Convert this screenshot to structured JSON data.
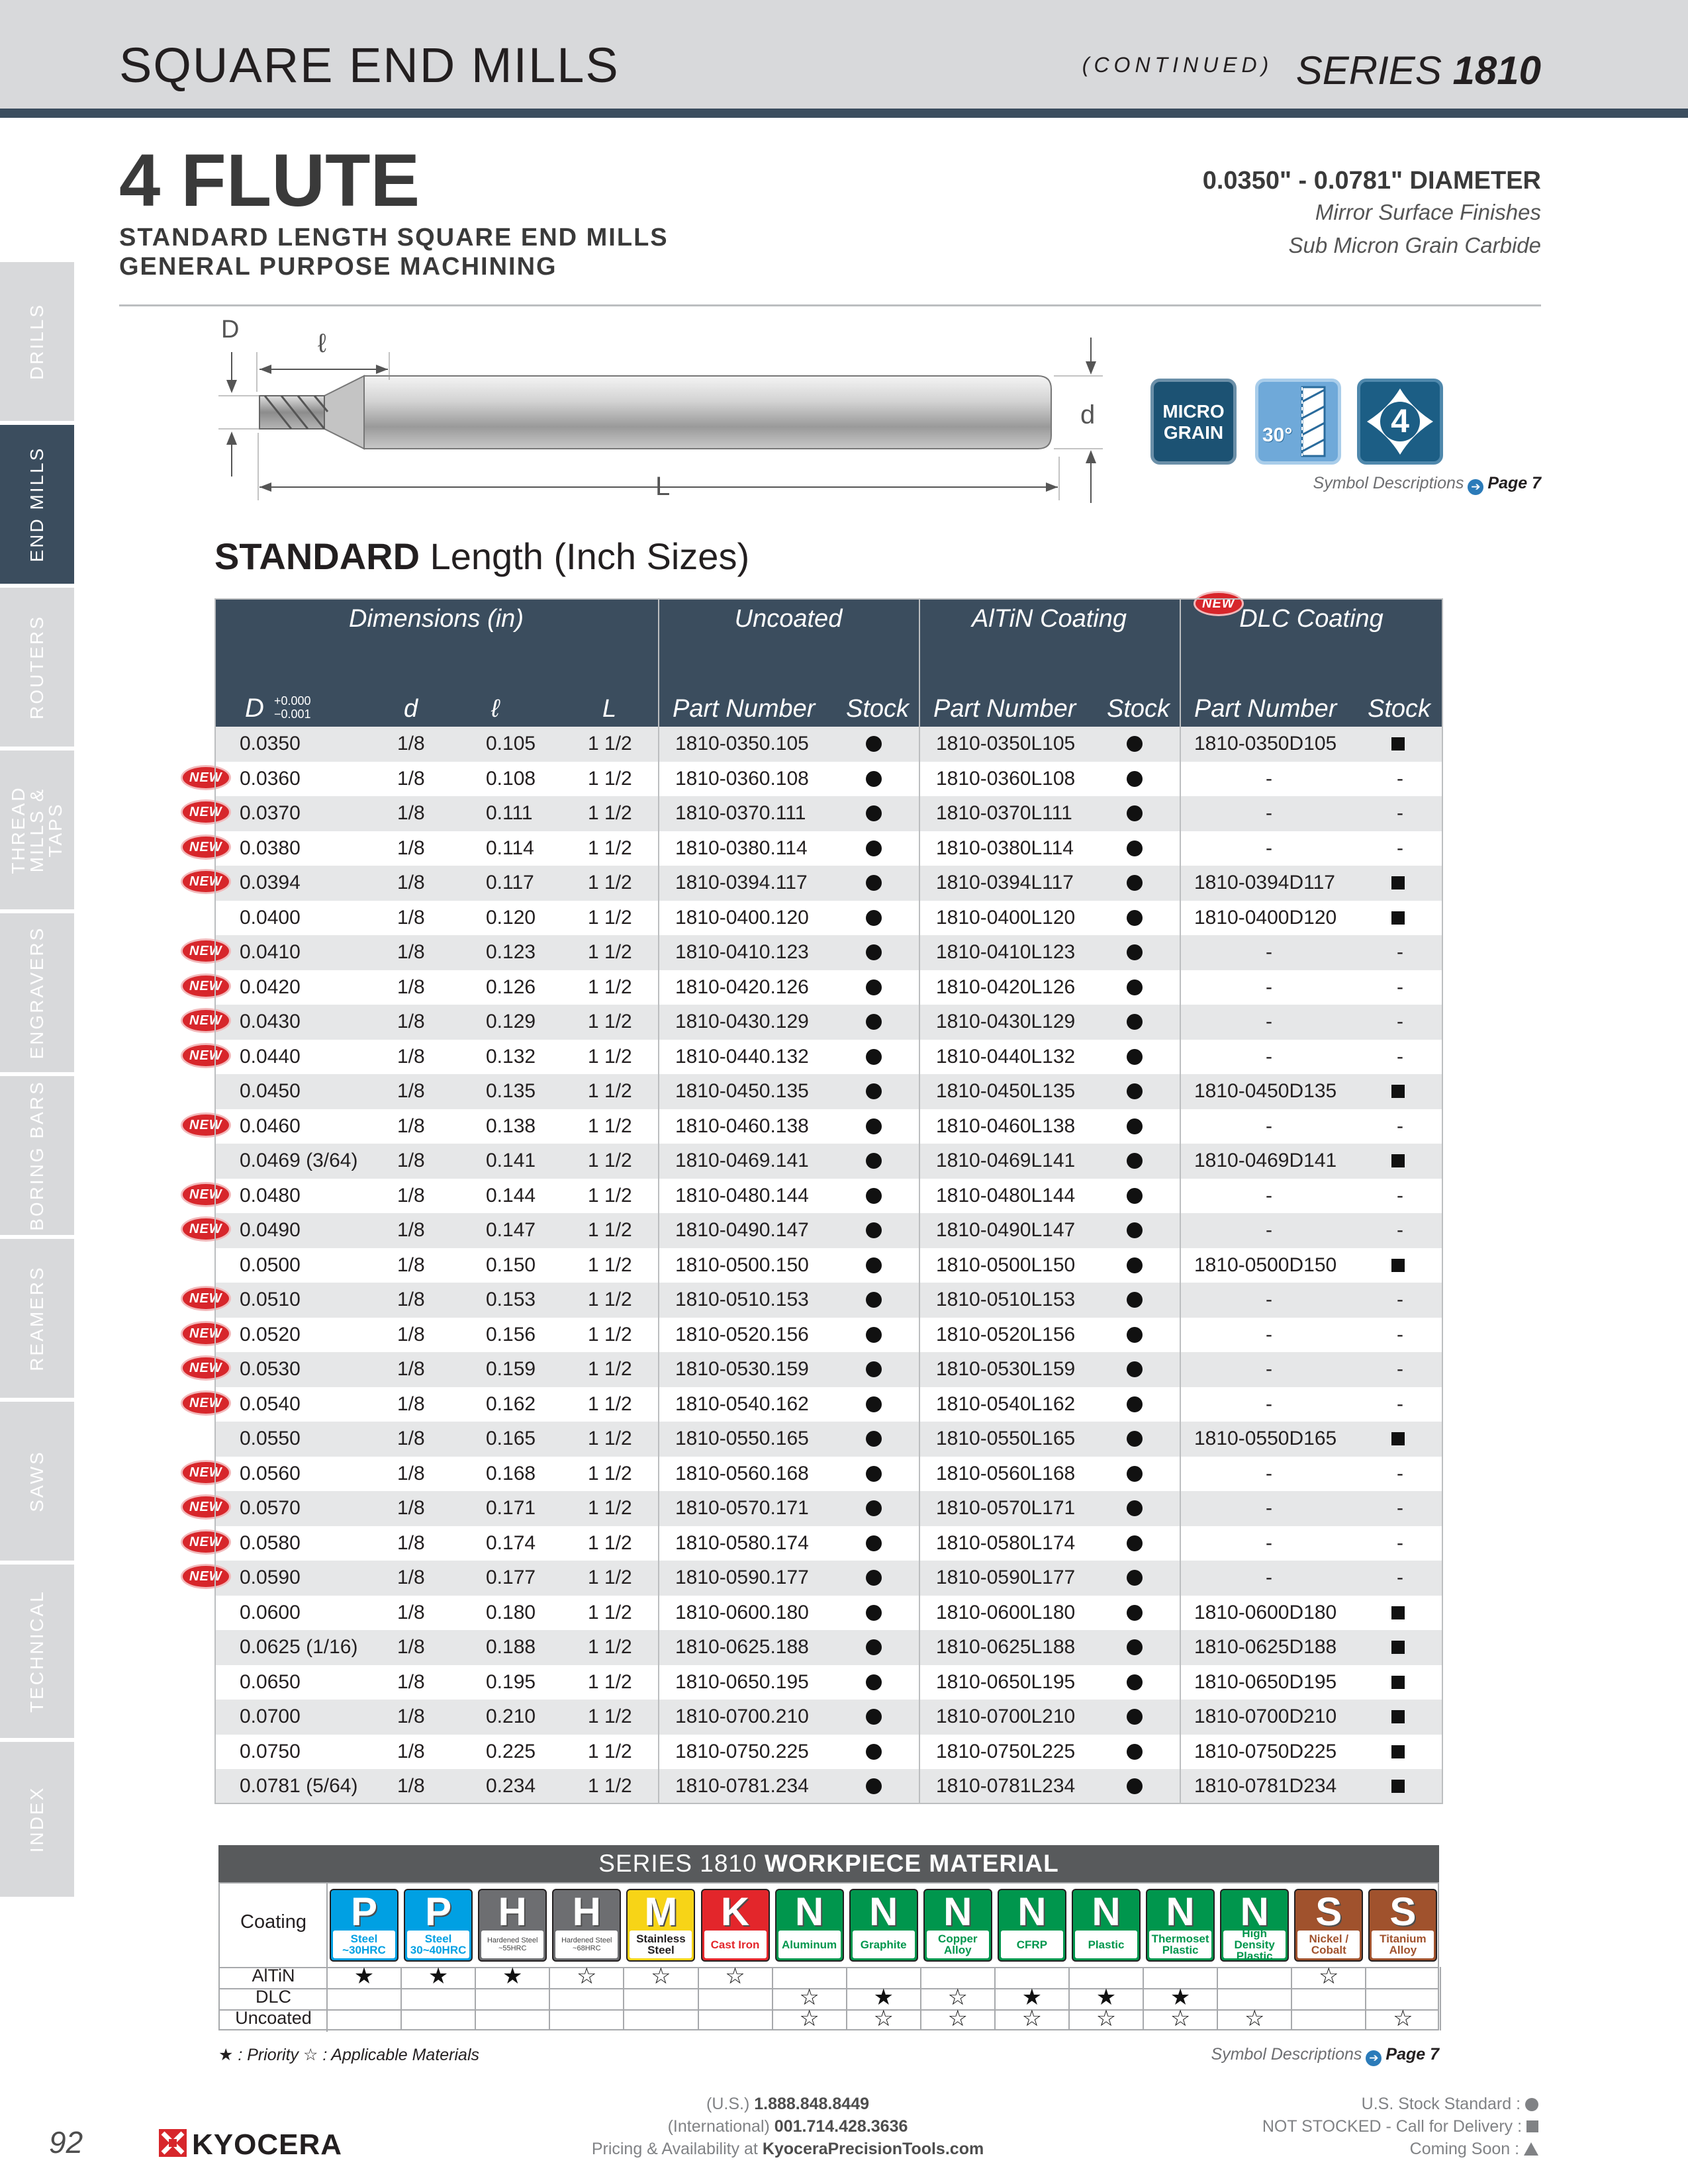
{
  "header": {
    "title": "SQUARE END MILLS",
    "continued": "(CONTINUED)",
    "series_prefix": "SERIES ",
    "series_number": "1810"
  },
  "side_tabs": [
    "DRILLS",
    "END MILLS",
    "ROUTERS",
    "THREAD MILLS & TAPS",
    "ENGRAVERS",
    "BORING BARS",
    "REAMERS",
    "SAWS",
    "TECHNICAL",
    "INDEX"
  ],
  "product": {
    "title": "4 FLUTE",
    "subtitle_line1": "STANDARD LENGTH SQUARE END MILLS",
    "subtitle_line2": "GENERAL PURPOSE MACHINING",
    "diameter_range": "0.0350\" - 0.0781\" DIAMETER",
    "finish_line1": "Mirror Surface Finishes",
    "finish_line2": "Sub Micron Grain Carbide"
  },
  "drawing": {
    "D": "D",
    "l": "ℓ",
    "L": "L",
    "d": "d"
  },
  "symbols": {
    "micro_grain_line1": "MICRO",
    "micro_grain_line2": "GRAIN",
    "helix": "30°",
    "flutes": "4",
    "ref_text": "Symbol Descriptions",
    "ref_page": "Page 7"
  },
  "table": {
    "heading_bold": "STANDARD",
    "heading_rest": " Length (Inch Sizes)",
    "groups": {
      "dimensions": "Dimensions (in)",
      "uncoated": "Uncoated",
      "altin": "AlTiN Coating",
      "dlc": "DLC Coating",
      "new_label": "NEW"
    },
    "columns": {
      "D": "D",
      "tol_plus": "+0.000",
      "tol_minus": "−0.001",
      "d": "d",
      "l": "ℓ",
      "L": "L",
      "part_number": "Part Number",
      "stock": "Stock"
    },
    "rows": [
      {
        "D": "0.0350",
        "new": false,
        "d": "1/8",
        "l": "0.105",
        "L": "1 1/2",
        "unc": "1810-0350.105",
        "alt": "1810-0350L105",
        "dlc": "1810-0350D105"
      },
      {
        "D": "0.0360",
        "new": true,
        "d": "1/8",
        "l": "0.108",
        "L": "1 1/2",
        "unc": "1810-0360.108",
        "alt": "1810-0360L108",
        "dlc": "-"
      },
      {
        "D": "0.0370",
        "new": true,
        "d": "1/8",
        "l": "0.111",
        "L": "1 1/2",
        "unc": "1810-0370.111",
        "alt": "1810-0370L111",
        "dlc": "-"
      },
      {
        "D": "0.0380",
        "new": true,
        "d": "1/8",
        "l": "0.114",
        "L": "1 1/2",
        "unc": "1810-0380.114",
        "alt": "1810-0380L114",
        "dlc": "-"
      },
      {
        "D": "0.0394",
        "new": true,
        "d": "1/8",
        "l": "0.117",
        "L": "1 1/2",
        "unc": "1810-0394.117",
        "alt": "1810-0394L117",
        "dlc": "1810-0394D117"
      },
      {
        "D": "0.0400",
        "new": false,
        "d": "1/8",
        "l": "0.120",
        "L": "1 1/2",
        "unc": "1810-0400.120",
        "alt": "1810-0400L120",
        "dlc": "1810-0400D120"
      },
      {
        "D": "0.0410",
        "new": true,
        "d": "1/8",
        "l": "0.123",
        "L": "1 1/2",
        "unc": "1810-0410.123",
        "alt": "1810-0410L123",
        "dlc": "-"
      },
      {
        "D": "0.0420",
        "new": true,
        "d": "1/8",
        "l": "0.126",
        "L": "1 1/2",
        "unc": "1810-0420.126",
        "alt": "1810-0420L126",
        "dlc": "-"
      },
      {
        "D": "0.0430",
        "new": true,
        "d": "1/8",
        "l": "0.129",
        "L": "1 1/2",
        "unc": "1810-0430.129",
        "alt": "1810-0430L129",
        "dlc": "-"
      },
      {
        "D": "0.0440",
        "new": true,
        "d": "1/8",
        "l": "0.132",
        "L": "1 1/2",
        "unc": "1810-0440.132",
        "alt": "1810-0440L132",
        "dlc": "-"
      },
      {
        "D": "0.0450",
        "new": false,
        "d": "1/8",
        "l": "0.135",
        "L": "1 1/2",
        "unc": "1810-0450.135",
        "alt": "1810-0450L135",
        "dlc": "1810-0450D135"
      },
      {
        "D": "0.0460",
        "new": true,
        "d": "1/8",
        "l": "0.138",
        "L": "1 1/2",
        "unc": "1810-0460.138",
        "alt": "1810-0460L138",
        "dlc": "-"
      },
      {
        "D": "0.0469 (3/64)",
        "new": false,
        "d": "1/8",
        "l": "0.141",
        "L": "1 1/2",
        "unc": "1810-0469.141",
        "alt": "1810-0469L141",
        "dlc": "1810-0469D141"
      },
      {
        "D": "0.0480",
        "new": true,
        "d": "1/8",
        "l": "0.144",
        "L": "1 1/2",
        "unc": "1810-0480.144",
        "alt": "1810-0480L144",
        "dlc": "-"
      },
      {
        "D": "0.0490",
        "new": true,
        "d": "1/8",
        "l": "0.147",
        "L": "1 1/2",
        "unc": "1810-0490.147",
        "alt": "1810-0490L147",
        "dlc": "-"
      },
      {
        "D": "0.0500",
        "new": false,
        "d": "1/8",
        "l": "0.150",
        "L": "1 1/2",
        "unc": "1810-0500.150",
        "alt": "1810-0500L150",
        "dlc": "1810-0500D150"
      },
      {
        "D": "0.0510",
        "new": true,
        "d": "1/8",
        "l": "0.153",
        "L": "1 1/2",
        "unc": "1810-0510.153",
        "alt": "1810-0510L153",
        "dlc": "-"
      },
      {
        "D": "0.0520",
        "new": true,
        "d": "1/8",
        "l": "0.156",
        "L": "1 1/2",
        "unc": "1810-0520.156",
        "alt": "1810-0520L156",
        "dlc": "-"
      },
      {
        "D": "0.0530",
        "new": true,
        "d": "1/8",
        "l": "0.159",
        "L": "1 1/2",
        "unc": "1810-0530.159",
        "alt": "1810-0530L159",
        "dlc": "-"
      },
      {
        "D": "0.0540",
        "new": true,
        "d": "1/8",
        "l": "0.162",
        "L": "1 1/2",
        "unc": "1810-0540.162",
        "alt": "1810-0540L162",
        "dlc": "-"
      },
      {
        "D": "0.0550",
        "new": false,
        "d": "1/8",
        "l": "0.165",
        "L": "1 1/2",
        "unc": "1810-0550.165",
        "alt": "1810-0550L165",
        "dlc": "1810-0550D165"
      },
      {
        "D": "0.0560",
        "new": true,
        "d": "1/8",
        "l": "0.168",
        "L": "1 1/2",
        "unc": "1810-0560.168",
        "alt": "1810-0560L168",
        "dlc": "-"
      },
      {
        "D": "0.0570",
        "new": true,
        "d": "1/8",
        "l": "0.171",
        "L": "1 1/2",
        "unc": "1810-0570.171",
        "alt": "1810-0570L171",
        "dlc": "-"
      },
      {
        "D": "0.0580",
        "new": true,
        "d": "1/8",
        "l": "0.174",
        "L": "1 1/2",
        "unc": "1810-0580.174",
        "alt": "1810-0580L174",
        "dlc": "-"
      },
      {
        "D": "0.0590",
        "new": true,
        "d": "1/8",
        "l": "0.177",
        "L": "1 1/2",
        "unc": "1810-0590.177",
        "alt": "1810-0590L177",
        "dlc": "-"
      },
      {
        "D": "0.0600",
        "new": false,
        "d": "1/8",
        "l": "0.180",
        "L": "1 1/2",
        "unc": "1810-0600.180",
        "alt": "1810-0600L180",
        "dlc": "1810-0600D180"
      },
      {
        "D": "0.0625 (1/16)",
        "new": false,
        "d": "1/8",
        "l": "0.188",
        "L": "1 1/2",
        "unc": "1810-0625.188",
        "alt": "1810-0625L188",
        "dlc": "1810-0625D188"
      },
      {
        "D": "0.0650",
        "new": false,
        "d": "1/8",
        "l": "0.195",
        "L": "1 1/2",
        "unc": "1810-0650.195",
        "alt": "1810-0650L195",
        "dlc": "1810-0650D195"
      },
      {
        "D": "0.0700",
        "new": false,
        "d": "1/8",
        "l": "0.210",
        "L": "1 1/2",
        "unc": "1810-0700.210",
        "alt": "1810-0700L210",
        "dlc": "1810-0700D210"
      },
      {
        "D": "0.0750",
        "new": false,
        "d": "1/8",
        "l": "0.225",
        "L": "1 1/2",
        "unc": "1810-0750.225",
        "alt": "1810-0750L225",
        "dlc": "1810-0750D225"
      },
      {
        "D": "0.0781 (5/64)",
        "new": false,
        "d": "1/8",
        "l": "0.234",
        "L": "1 1/2",
        "unc": "1810-0781.234",
        "alt": "1810-0781L234",
        "dlc": "1810-0781D234"
      }
    ]
  },
  "workpiece": {
    "title_prefix": "SERIES 1810 ",
    "title_bold": "WORKPIECE MATERIAL",
    "coating_label": "Coating",
    "materials": [
      {
        "letter": "P",
        "name": "Steel ~30HRC",
        "color": "#00a0e3",
        "small": false
      },
      {
        "letter": "P",
        "name": "Steel 30~40HRC",
        "color": "#00a0e3",
        "small": false
      },
      {
        "letter": "H",
        "name": "Hardened Steel ~55HRC",
        "color": "#6d6e71",
        "small": true
      },
      {
        "letter": "H",
        "name": "Hardened Steel ~68HRC",
        "color": "#6d6e71",
        "small": true
      },
      {
        "letter": "M",
        "name": "Stainless Steel",
        "color": "#f7d417",
        "small": false
      },
      {
        "letter": "K",
        "name": "Cast Iron",
        "color": "#e3262b",
        "small": false
      },
      {
        "letter": "N",
        "name": "Aluminum",
        "color": "#00964d",
        "small": false
      },
      {
        "letter": "N",
        "name": "Graphite",
        "color": "#00964d",
        "small": false
      },
      {
        "letter": "N",
        "name": "Copper Alloy",
        "color": "#00964d",
        "small": false
      },
      {
        "letter": "N",
        "name": "CFRP",
        "color": "#00964d",
        "small": false
      },
      {
        "letter": "N",
        "name": "Plastic",
        "color": "#00964d",
        "small": false
      },
      {
        "letter": "N",
        "name": "Thermoset Plastic",
        "color": "#00964d",
        "small": false
      },
      {
        "letter": "N",
        "name": "High Density Plastic",
        "color": "#00964d",
        "small": false
      },
      {
        "letter": "S",
        "name": "Nickel / Cobalt",
        "color": "#a0522d",
        "small": false
      },
      {
        "letter": "S",
        "name": "Titanium Alloy",
        "color": "#a0522d",
        "small": false
      }
    ],
    "rows": [
      {
        "label": "AlTiN",
        "marks": [
          "★",
          "★",
          "★",
          "☆",
          "☆",
          "☆",
          "",
          "",
          "",
          "",
          "",
          "",
          "",
          "☆",
          ""
        ]
      },
      {
        "label": "DLC",
        "marks": [
          "",
          "",
          "",
          "",
          "",
          "",
          "☆",
          "★",
          "☆",
          "★",
          "★",
          "★",
          "",
          "",
          ""
        ]
      },
      {
        "label": "Uncoated",
        "marks": [
          "",
          "",
          "",
          "",
          "",
          "",
          "☆",
          "☆",
          "☆",
          "☆",
          "☆",
          "☆",
          "☆",
          "",
          "☆"
        ]
      }
    ],
    "legend": "★ : Priority   ☆ : Applicable Materials",
    "ref_text": "Symbol Descriptions",
    "ref_page": "Page 7"
  },
  "footer": {
    "page_number": "92",
    "brand": "KYOCERA",
    "us_label": "(U.S.) ",
    "us_phone": "1.888.848.8449",
    "intl_label": "(International) ",
    "intl_phone": "001.714.428.3636",
    "pricing_label": "Pricing & Availability at ",
    "website": "KyoceraPrecisionTools.com",
    "stock_standard": "U.S. Stock Standard :",
    "not_stocked": "NOT STOCKED - Call for Delivery :",
    "coming_soon": "Coming Soon :"
  },
  "colors": {
    "header_band": "#d8d9db",
    "header_rule": "#3b4d5e",
    "table_header": "#3b4d5e",
    "row_shade": "#e6e7e8",
    "new_badge": "#d7262b"
  }
}
